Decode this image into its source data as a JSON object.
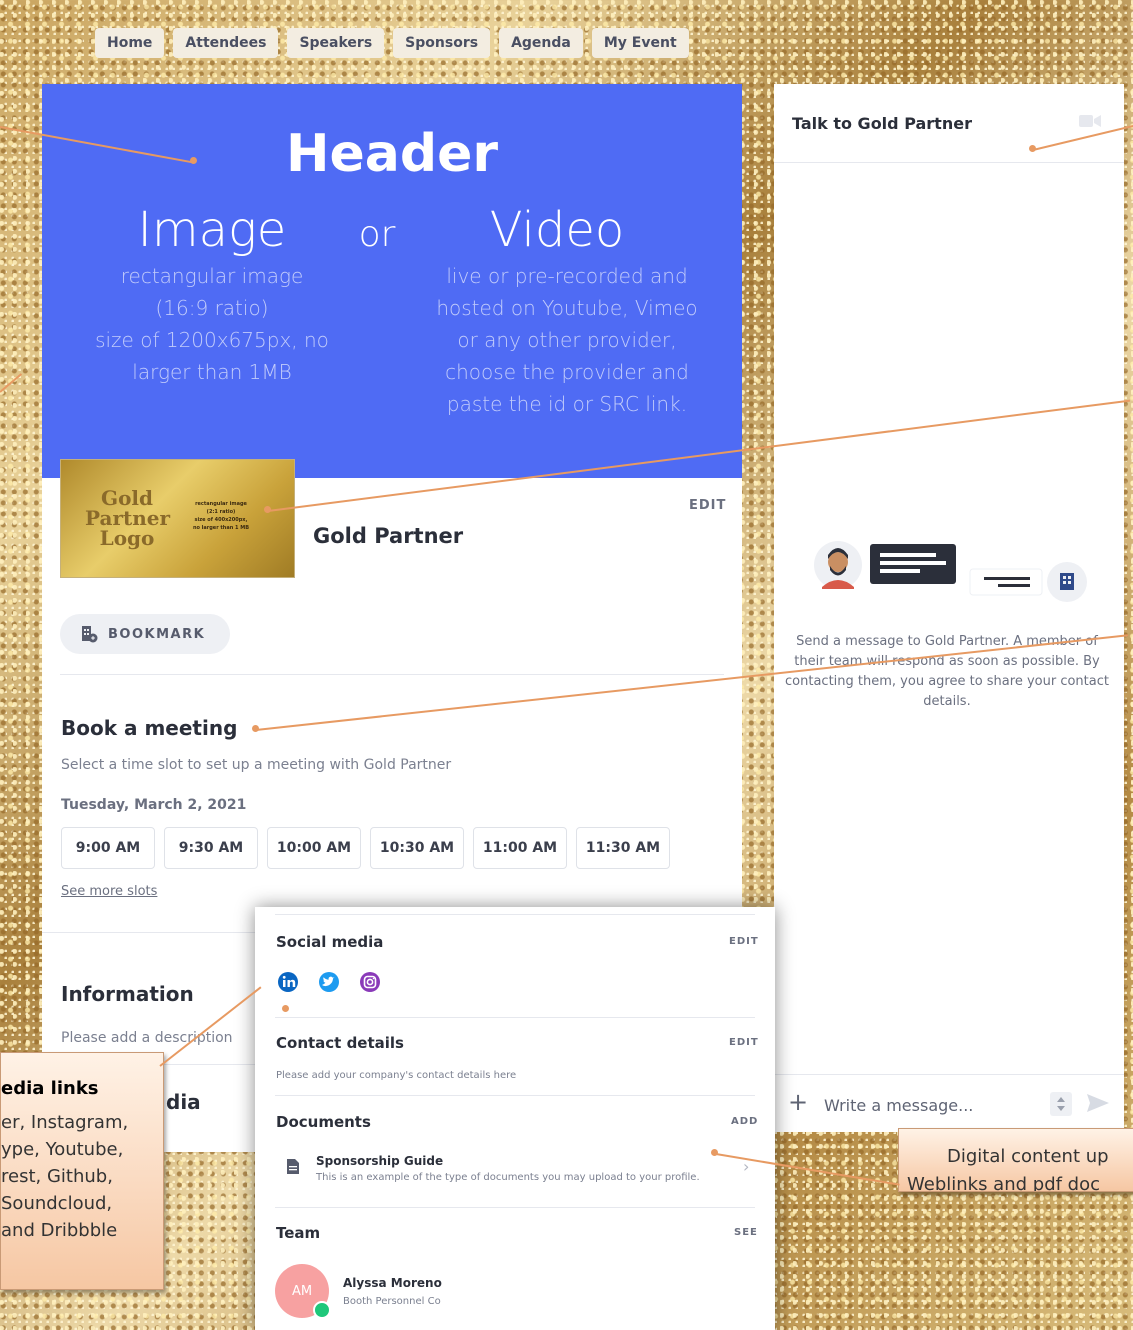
{
  "nav": [
    "Home",
    "Attendees",
    "Speakers",
    "Sponsors",
    "Agenda",
    "My Event"
  ],
  "hero": {
    "title": "Header",
    "image_label": "Image",
    "or_label": "or",
    "video_label": "Video",
    "image_desc": [
      "rectangular image",
      "(16:9 ratio)",
      "size of 1200x675px, no",
      "larger than 1MB"
    ],
    "video_desc": [
      "live or pre-recorded and",
      "hosted on Youtube, Vimeo",
      "or any other provider,",
      "choose the provider and",
      "paste the id or SRC link."
    ],
    "color": "#4f6bf4"
  },
  "logo": {
    "text": [
      "Gold",
      "Partner",
      "Logo"
    ],
    "small": [
      "rectangular image",
      "(2:1 ratio)",
      "size of 400x200px,",
      "no larger than 1 MB"
    ]
  },
  "sponsor": {
    "name": "Gold Partner",
    "edit_label": "EDIT",
    "bookmark_label": "BOOKMARK"
  },
  "meeting": {
    "title": "Book a meeting",
    "subtitle": "Select a time slot to set up a meeting with Gold Partner",
    "date": "Tuesday, March 2, 2021",
    "slots": [
      "9:00 AM",
      "9:30 AM",
      "10:00 AM",
      "10:30 AM",
      "11:00 AM",
      "11:30 AM"
    ],
    "more_link": "See more slots"
  },
  "information": {
    "title": "Information",
    "placeholder": "Please add a description"
  },
  "hidden_social_title_fragment": "dia",
  "chat": {
    "title": "Talk to Gold Partner",
    "message": "Send a message to Gold Partner. A member of their team will respond as soon as possible. By contacting them, you agree to share your contact details.",
    "input_placeholder": "Write a message..."
  },
  "popup": {
    "social": {
      "title": "Social media",
      "edit": "EDIT",
      "icons": [
        "linkedin-icon",
        "twitter-icon",
        "instagram-icon"
      ]
    },
    "contact": {
      "title": "Contact details",
      "edit": "EDIT",
      "placeholder": "Please add your company's contact details here"
    },
    "documents": {
      "title": "Documents",
      "add": "ADD",
      "doc_title": "Sponsorship Guide",
      "doc_desc": "This is an example of the type of documents you may upload to your profile."
    },
    "team": {
      "title": "Team",
      "see": "SEE",
      "initials": "AM",
      "member_name": "Alyssa Moreno",
      "member_role": "Booth Personnel Co"
    }
  },
  "callouts": {
    "social": {
      "title": "edia links",
      "lines": [
        "er, Instagram,",
        "ype, Youtube,",
        "rest, Github,",
        " Soundcloud,",
        "and Dribbble"
      ]
    },
    "digital": {
      "title": "Digital content up",
      "lines": [
        "Weblinks and pdf doc"
      ]
    }
  },
  "colors": {
    "accent": "#4f6bf4",
    "callout_line": "#e79a62",
    "online": "#1fc77a",
    "avatar_bg": "#f7a1a1"
  }
}
